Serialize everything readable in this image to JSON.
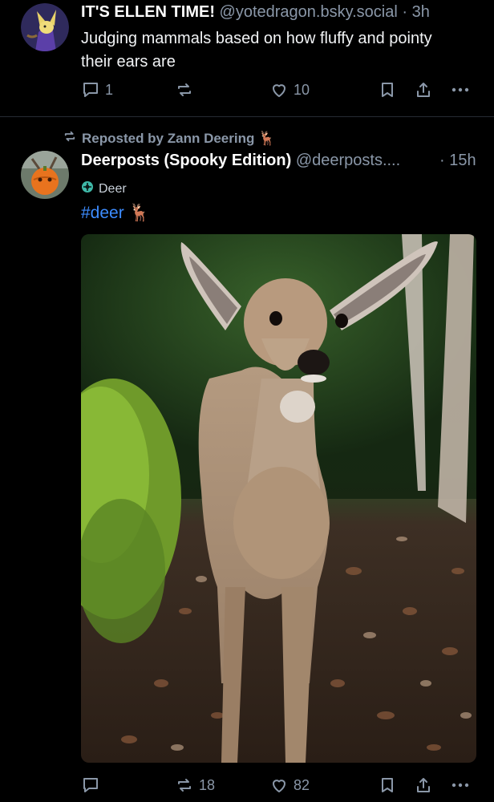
{
  "post1": {
    "display_name": "IT'S ELLEN TIME!",
    "handle": "@yotedragon.bsky.social",
    "time": "· 3h",
    "text": "Judging mammals based on how fluffy and pointy their ears are",
    "reply_count": "1",
    "repost_count": "",
    "like_count": "10"
  },
  "post2": {
    "reposted_by": "Reposted by Zann Deering 🦌",
    "display_name": "Deerposts (Spooky Edition)",
    "handle": "@deerposts....",
    "time": "· 15h",
    "label": "Deer",
    "hashtag": "#deer",
    "hashtag_emoji": "🦌",
    "reply_count": "",
    "repost_count": "18",
    "like_count": "82"
  },
  "icons": [
    "reply-icon",
    "repost-icon",
    "like-icon",
    "bookmark-icon",
    "share-icon",
    "more-icon",
    "label-icon"
  ],
  "colors": {
    "background": "#000000",
    "muted": "#8a97a8",
    "link": "#3d8cff",
    "divider": "#262b33"
  }
}
